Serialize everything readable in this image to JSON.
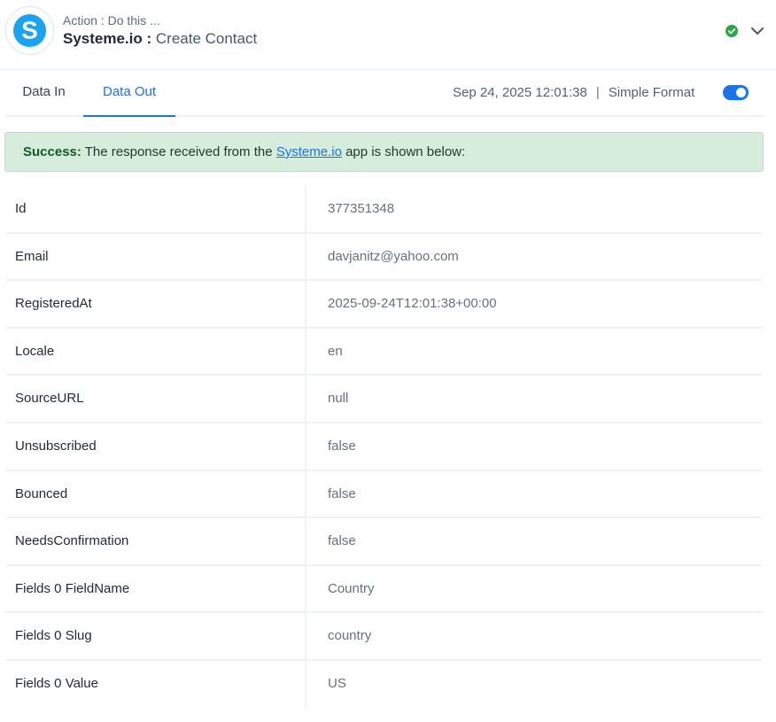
{
  "header": {
    "kicker": "Action : Do this ...",
    "app_name": "Systeme.io",
    "separator": " : ",
    "action_name": "Create Contact",
    "logo_letter": "S",
    "status_icon": "check-circle-icon",
    "brand_color": "#1aa3f0"
  },
  "tabs": {
    "data_in": "Data In",
    "data_out": "Data Out",
    "active": "Data Out"
  },
  "meta": {
    "timestamp": "Sep 24, 2025 12:01:38",
    "separator": "|",
    "format_label": "Simple Format",
    "format_enabled": true
  },
  "alert": {
    "strong": "Success:",
    "before_link": " The response received from the ",
    "link": "Systeme.io",
    "after_link": " app is shown below:"
  },
  "rows": [
    {
      "key": "Id",
      "value": "377351348"
    },
    {
      "key": "Email",
      "value": "davjanitz@yahoo.com"
    },
    {
      "key": "RegisteredAt",
      "value": "2025-09-24T12:01:38+00:00"
    },
    {
      "key": "Locale",
      "value": "en"
    },
    {
      "key": "SourceURL",
      "value": "null"
    },
    {
      "key": "Unsubscribed",
      "value": "false"
    },
    {
      "key": "Bounced",
      "value": "false"
    },
    {
      "key": "NeedsConfirmation",
      "value": "false"
    },
    {
      "key": "Fields 0 FieldName",
      "value": "Country"
    },
    {
      "key": "Fields 0 Slug",
      "value": "country"
    },
    {
      "key": "Fields 0 Value",
      "value": "US"
    }
  ]
}
